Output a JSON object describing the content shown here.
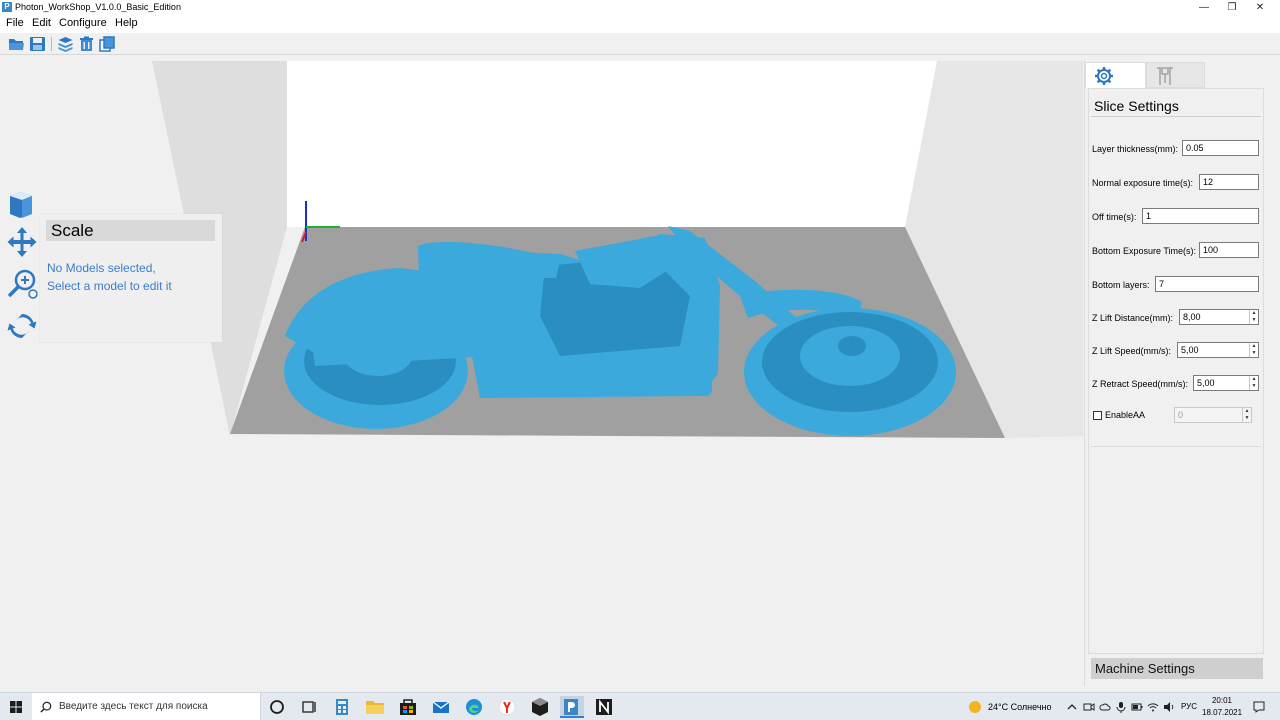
{
  "window": {
    "app_icon_letter": "P",
    "title": "Photon_WorkShop_V1.0.0_Basic_Edition",
    "minimize": "—",
    "restore": "❐",
    "close": "✕"
  },
  "menu": {
    "items": [
      "File",
      "Edit",
      "Configure",
      "Help"
    ]
  },
  "toolbar": {
    "icons": [
      "open-folder-icon",
      "save-icon",
      "slice-layers-icon",
      "delete-icon",
      "copy-icon"
    ]
  },
  "left_tools": {
    "icons": [
      "cube-view-icon",
      "move-icon",
      "scale-icon",
      "rotate-icon"
    ]
  },
  "scale_panel": {
    "title": "Scale",
    "message_line1": "No Models selected,",
    "message_line2": "Select a model to edit it"
  },
  "right_panel": {
    "tabs": [
      "slice-settings-gear-icon",
      "machine-settings-icon"
    ],
    "title": "Slice Settings",
    "fields": [
      {
        "label": "Layer thickness(mm):",
        "value": "0.05"
      },
      {
        "label": "Normal exposure time(s):",
        "value": "12"
      },
      {
        "label": "Off time(s):",
        "value": "1"
      },
      {
        "label": "Bottom Exposure Time(s):",
        "value": "100"
      },
      {
        "label": "Bottom layers:",
        "value": "7"
      },
      {
        "label": "Z Lift Distance(mm):",
        "value": "8,00"
      },
      {
        "label": "Z Lift Speed(mm/s):",
        "value": "5,00"
      },
      {
        "label": "Z Retract Speed(mm/s):",
        "value": "5,00"
      }
    ],
    "enable_aa": {
      "label": "EnableAA",
      "checked": false,
      "value": "0"
    },
    "machine_settings": "Machine Settings"
  },
  "scene": {
    "model_color": "#3ba9dc",
    "build_plate_color": "#a0a0a0",
    "back_wall_color": "#ffffff",
    "side_wall_color": "#dedede"
  },
  "taskbar": {
    "search_placeholder": "Введите здесь текст для поиска",
    "weather": "24°C  Солнечно",
    "language": "РУС",
    "time": "20:01",
    "date": "18.07.2021"
  }
}
